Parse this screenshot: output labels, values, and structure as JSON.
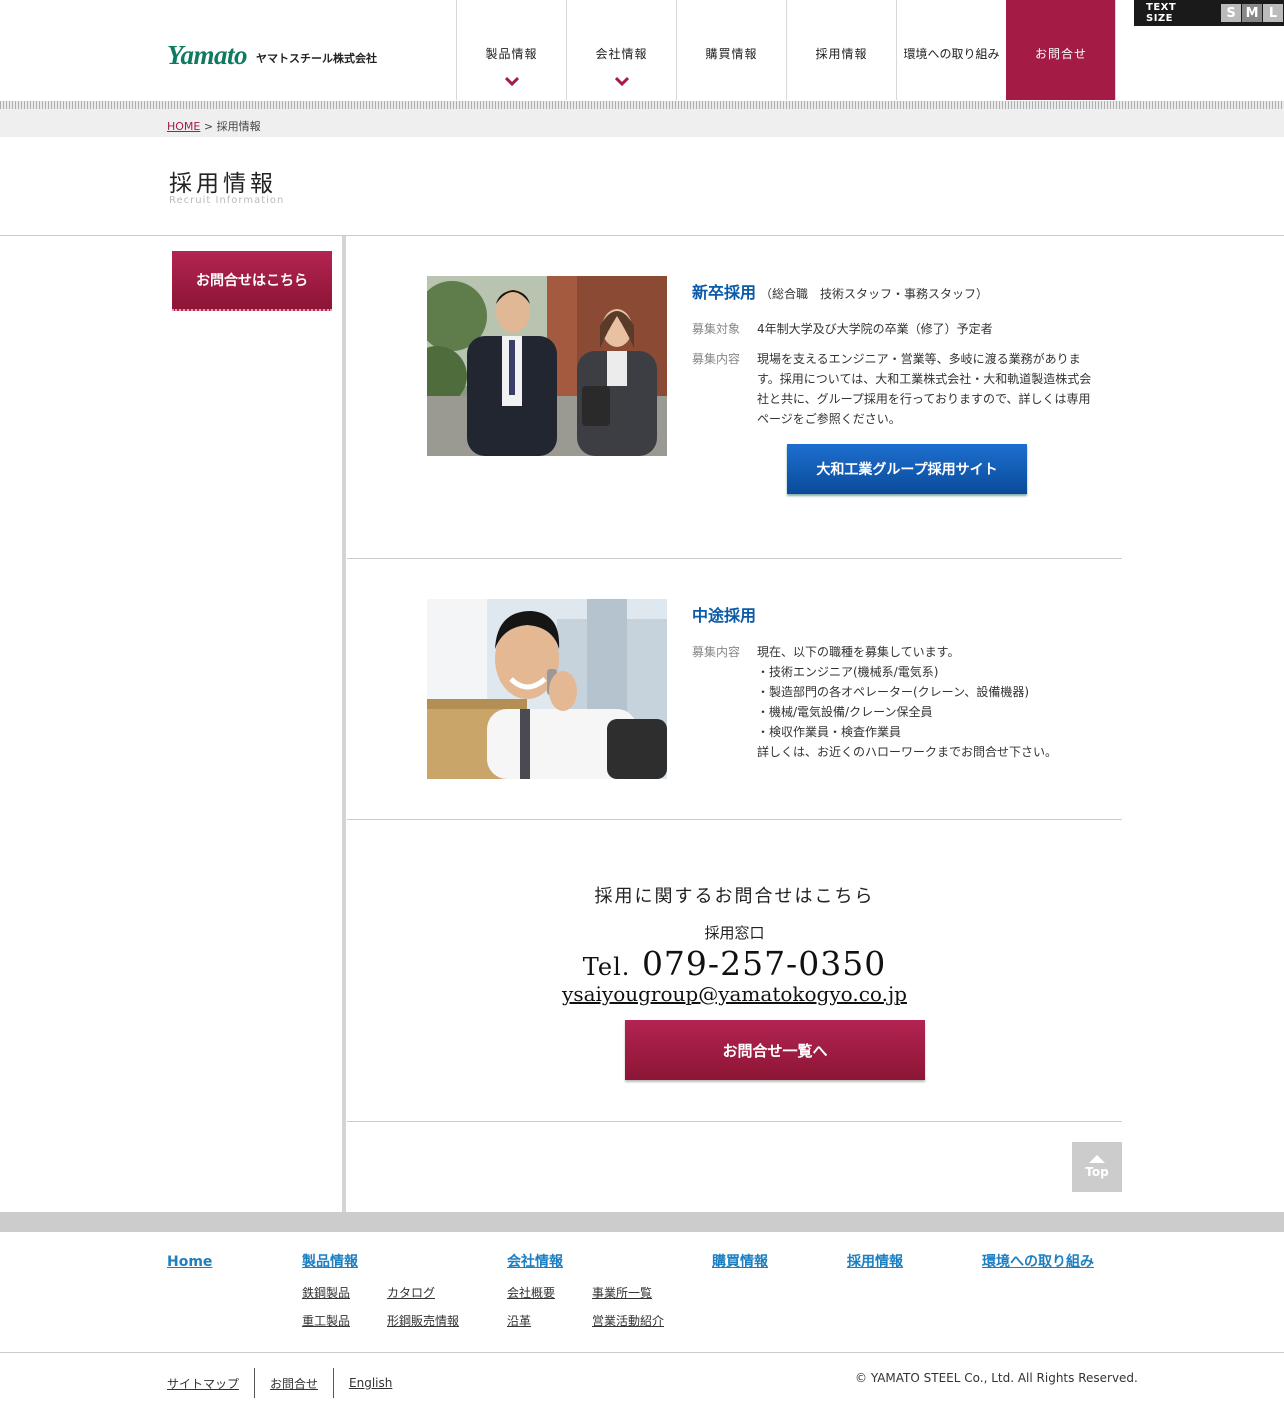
{
  "header": {
    "logo_text": "Yamato",
    "company_name": "ヤマトスチール株式会社",
    "nav": [
      {
        "label": "製品情報",
        "has_dropdown": true
      },
      {
        "label": "会社情報",
        "has_dropdown": true
      },
      {
        "label": "購買情報",
        "has_dropdown": false
      },
      {
        "label": "採用情報",
        "has_dropdown": false
      },
      {
        "label": "環境への取り組み",
        "has_dropdown": false
      },
      {
        "label": "お問合せ",
        "has_dropdown": false
      }
    ],
    "text_size": {
      "label": "TEXT SIZE",
      "options": [
        "S",
        "M",
        "L"
      ],
      "selected": "M"
    }
  },
  "breadcrumb": {
    "home": "HOME",
    "separator": " > ",
    "current": "採用情報"
  },
  "page": {
    "title": "採用情報",
    "subtitle": "Recruit Information"
  },
  "sidebar": {
    "contact_button": "お問合せはこちら"
  },
  "sections": [
    {
      "title": "新卒採用",
      "title_note": "（総合職　技術スタッフ・事務スタッフ）",
      "rows": [
        {
          "key": "募集対象",
          "value": "4年制大学及び大学院の卒業（修了）予定者"
        },
        {
          "key": "募集内容",
          "value": "現場を支えるエンジニア・営業等、多岐に渡る業務があります。採用については、大和工業株式会社・大和軌道製造株式会社と共に、グループ採用を行っておりますので、詳しくは専用ページをご参照ください。"
        }
      ],
      "button": "大和工業グループ採用サイト"
    },
    {
      "title": "中途採用",
      "rows": [
        {
          "key": "募集内容",
          "lines": [
            "現在、以下の職種を募集しています。",
            "・技術エンジニア(機械系/電気系)",
            "・製造部門の各オペレーター(クレーン、設備機器)",
            "・機械/電気設備/クレーン保全員",
            "・検収作業員・検査作業員",
            "詳しくは、お近くのハローワークまでお問合せ下さい。"
          ]
        }
      ]
    }
  ],
  "contact": {
    "heading": "採用に関するお問合せはこちら",
    "desk": "採用窓口",
    "tel_prefix": "Tel.",
    "tel": "079-257-0350",
    "email": "ysaiyougroup@yamatokogyo.co.jp",
    "button": "お問合せ一覧へ"
  },
  "top_button": "Top",
  "footer": {
    "columns": [
      {
        "head": "Home",
        "links": []
      },
      {
        "head": "製品情報",
        "links": [
          "鉄鋼製品",
          "カタログ",
          "重工製品",
          "形鋼販売情報"
        ]
      },
      {
        "head": "会社情報",
        "links": [
          "会社概要",
          "事業所一覧",
          "沿革",
          "営業活動紹介"
        ]
      },
      {
        "head": "購買情報",
        "links": []
      },
      {
        "head": "採用情報",
        "links": []
      },
      {
        "head": "環境への取り組み",
        "links": []
      }
    ],
    "bottom_links": [
      "サイトマップ",
      "お問合せ",
      "English"
    ],
    "copyright": "© YAMATO STEEL Co., Ltd. All Rights Reserved."
  },
  "colors": {
    "brand_red": "#a41c46",
    "brand_green": "#0e7a5f",
    "link_blue": "#1b7fc1",
    "title_blue": "#0a5aa8"
  }
}
